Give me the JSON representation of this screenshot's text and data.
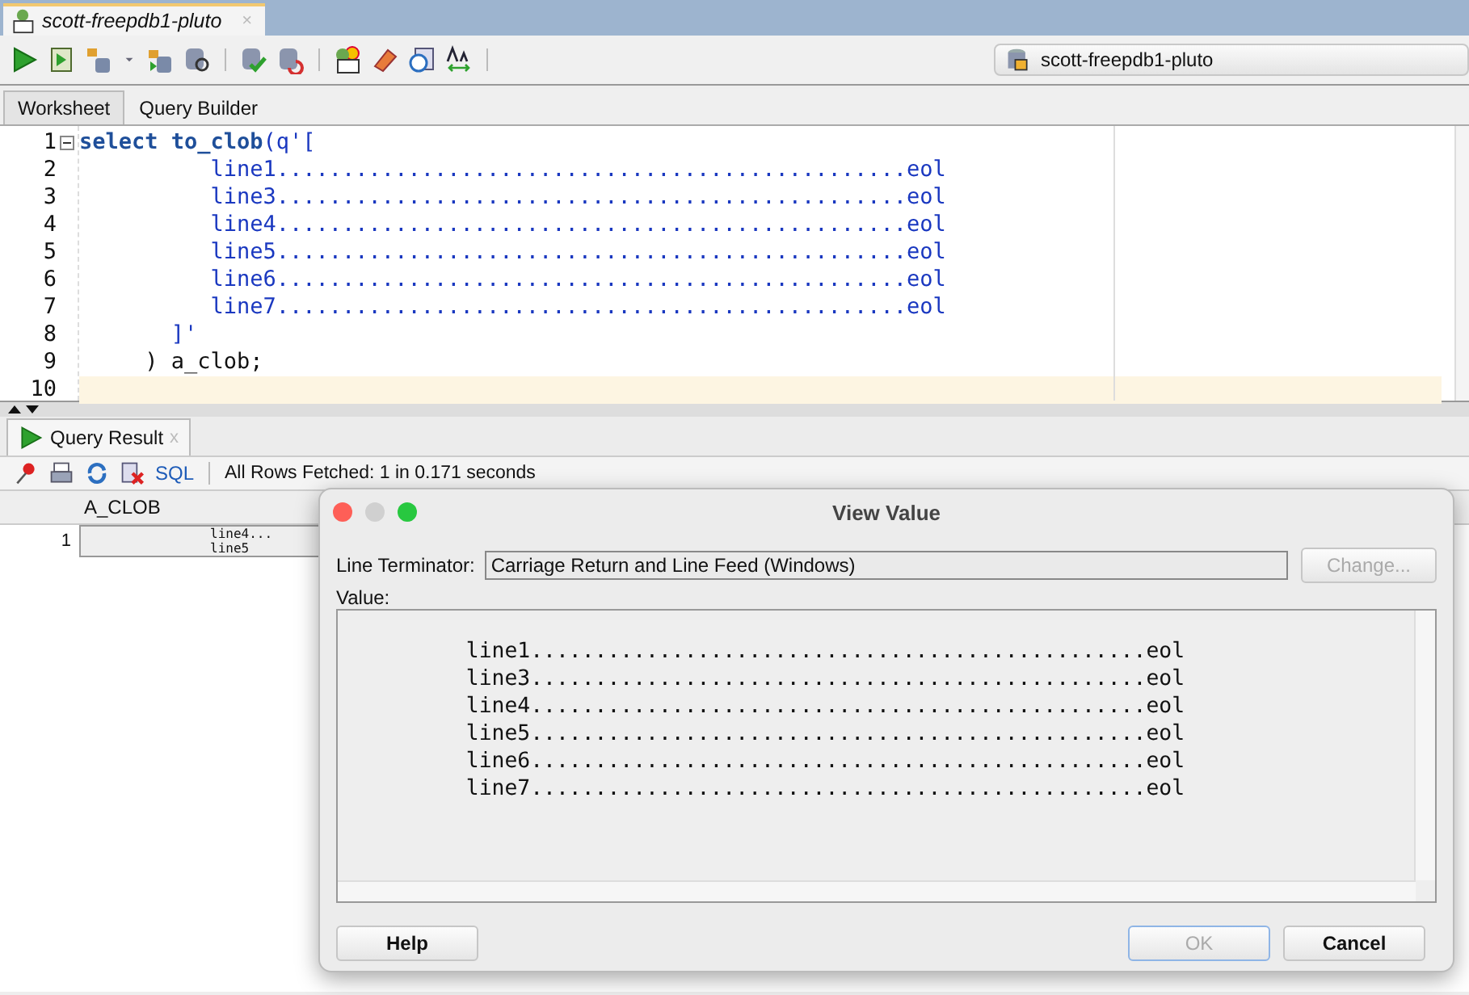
{
  "window": {
    "tab": {
      "title": "scott-freepdb1-pluto",
      "close": "×"
    }
  },
  "toolbar": {
    "connection": "scott-freepdb1-pluto"
  },
  "editor_tabs": [
    {
      "label": "Worksheet",
      "selected": true
    },
    {
      "label": "Query Builder",
      "selected": false
    }
  ],
  "editor": {
    "lines": [
      {
        "number": "1",
        "foldable": true,
        "current": false,
        "segments": [
          {
            "kind": "keyword",
            "text": "select to_clob"
          },
          {
            "kind": "string",
            "text": "(q'["
          }
        ]
      },
      {
        "number": "2",
        "foldable": false,
        "current": false,
        "segments": [
          {
            "kind": "string",
            "text": "          line1................................................eol"
          }
        ]
      },
      {
        "number": "3",
        "foldable": false,
        "current": false,
        "segments": [
          {
            "kind": "string",
            "text": "          line3................................................eol"
          }
        ]
      },
      {
        "number": "4",
        "foldable": false,
        "current": false,
        "segments": [
          {
            "kind": "string",
            "text": "          line4................................................eol"
          }
        ]
      },
      {
        "number": "5",
        "foldable": false,
        "current": false,
        "segments": [
          {
            "kind": "string",
            "text": "          line5................................................eol"
          }
        ]
      },
      {
        "number": "6",
        "foldable": false,
        "current": false,
        "segments": [
          {
            "kind": "string",
            "text": "          line6................................................eol"
          }
        ]
      },
      {
        "number": "7",
        "foldable": false,
        "current": false,
        "segments": [
          {
            "kind": "string",
            "text": "          line7................................................eol"
          }
        ]
      },
      {
        "number": "8",
        "foldable": false,
        "current": false,
        "segments": [
          {
            "kind": "string",
            "text": "       ]'"
          }
        ]
      },
      {
        "number": "9",
        "foldable": false,
        "current": false,
        "segments": [
          {
            "kind": "plain",
            "text": "     ) a_clob;"
          }
        ]
      },
      {
        "number": "10",
        "foldable": false,
        "current": true
      }
    ]
  },
  "result": {
    "tab": {
      "label": "Query Result",
      "close": "x"
    },
    "sql_link": "SQL",
    "status": "All Rows Fetched: 1 in 0.171 seconds",
    "columns": [
      "A_CLOB"
    ],
    "rows": [
      {
        "number": "1",
        "cell_lines": [
          "line4...",
          "line5"
        ]
      }
    ]
  },
  "dialog": {
    "title": "View Value",
    "line_terminator_label": "Line Terminator:",
    "line_terminator": "Carriage Return and Line Feed (Windows)",
    "change_button": {
      "label": "Change...",
      "disabled": true
    },
    "value_label": "Value:",
    "value_lines": [
      "          line1................................................eol",
      "          line3................................................eol",
      "          line4................................................eol",
      "          line5................................................eol",
      "          line6................................................eol",
      "          line7................................................eol"
    ],
    "buttons": [
      {
        "label": "Help",
        "disabled": false,
        "kind": "left"
      },
      {
        "label": "OK",
        "disabled": true,
        "kind": "right"
      },
      {
        "label": "Cancel",
        "disabled": false,
        "kind": "right"
      }
    ]
  }
}
